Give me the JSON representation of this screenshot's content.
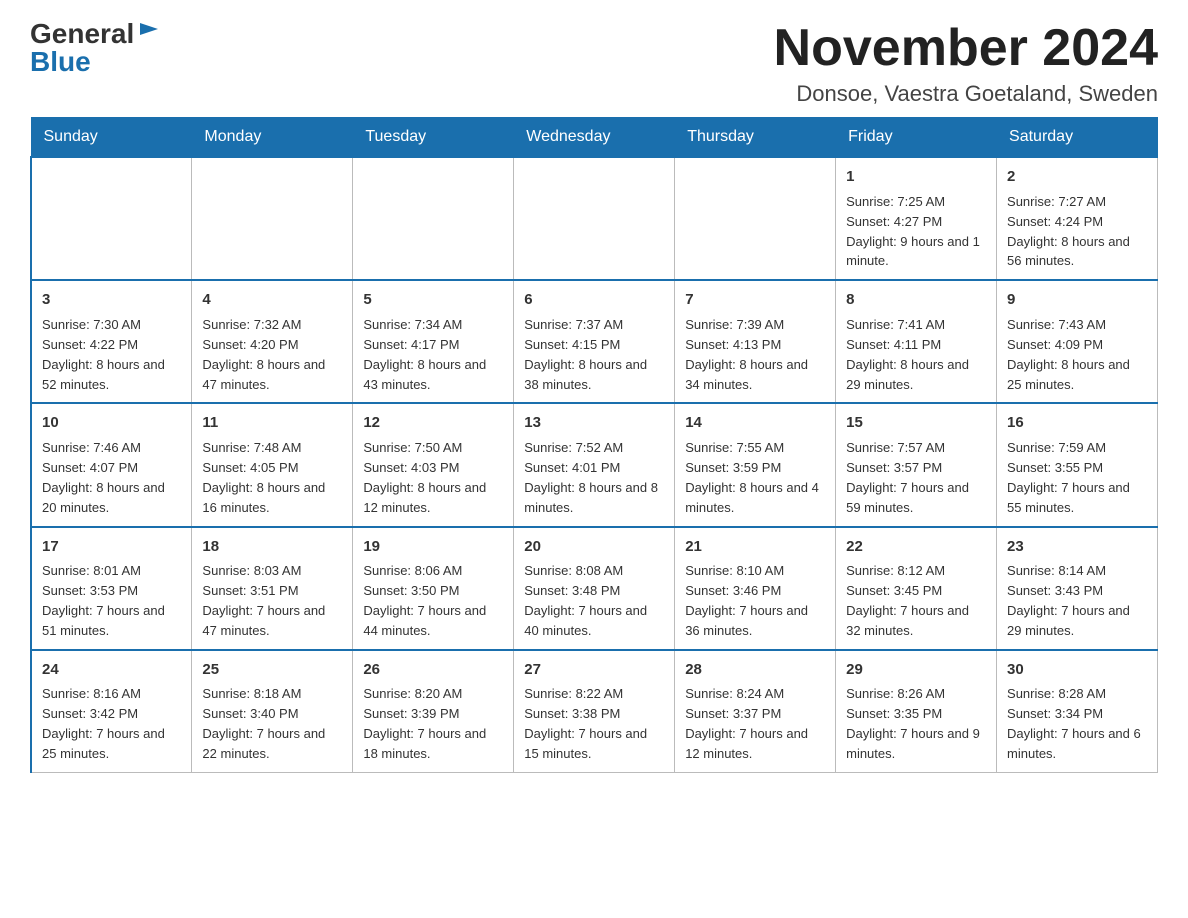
{
  "header": {
    "logo_general": "General",
    "logo_blue": "Blue",
    "month_title": "November 2024",
    "location": "Donsoe, Vaestra Goetaland, Sweden"
  },
  "days_of_week": [
    "Sunday",
    "Monday",
    "Tuesday",
    "Wednesday",
    "Thursday",
    "Friday",
    "Saturday"
  ],
  "weeks": [
    [
      {
        "day": "",
        "info": ""
      },
      {
        "day": "",
        "info": ""
      },
      {
        "day": "",
        "info": ""
      },
      {
        "day": "",
        "info": ""
      },
      {
        "day": "",
        "info": ""
      },
      {
        "day": "1",
        "info": "Sunrise: 7:25 AM\nSunset: 4:27 PM\nDaylight: 9 hours and 1 minute."
      },
      {
        "day": "2",
        "info": "Sunrise: 7:27 AM\nSunset: 4:24 PM\nDaylight: 8 hours and 56 minutes."
      }
    ],
    [
      {
        "day": "3",
        "info": "Sunrise: 7:30 AM\nSunset: 4:22 PM\nDaylight: 8 hours and 52 minutes."
      },
      {
        "day": "4",
        "info": "Sunrise: 7:32 AM\nSunset: 4:20 PM\nDaylight: 8 hours and 47 minutes."
      },
      {
        "day": "5",
        "info": "Sunrise: 7:34 AM\nSunset: 4:17 PM\nDaylight: 8 hours and 43 minutes."
      },
      {
        "day": "6",
        "info": "Sunrise: 7:37 AM\nSunset: 4:15 PM\nDaylight: 8 hours and 38 minutes."
      },
      {
        "day": "7",
        "info": "Sunrise: 7:39 AM\nSunset: 4:13 PM\nDaylight: 8 hours and 34 minutes."
      },
      {
        "day": "8",
        "info": "Sunrise: 7:41 AM\nSunset: 4:11 PM\nDaylight: 8 hours and 29 minutes."
      },
      {
        "day": "9",
        "info": "Sunrise: 7:43 AM\nSunset: 4:09 PM\nDaylight: 8 hours and 25 minutes."
      }
    ],
    [
      {
        "day": "10",
        "info": "Sunrise: 7:46 AM\nSunset: 4:07 PM\nDaylight: 8 hours and 20 minutes."
      },
      {
        "day": "11",
        "info": "Sunrise: 7:48 AM\nSunset: 4:05 PM\nDaylight: 8 hours and 16 minutes."
      },
      {
        "day": "12",
        "info": "Sunrise: 7:50 AM\nSunset: 4:03 PM\nDaylight: 8 hours and 12 minutes."
      },
      {
        "day": "13",
        "info": "Sunrise: 7:52 AM\nSunset: 4:01 PM\nDaylight: 8 hours and 8 minutes."
      },
      {
        "day": "14",
        "info": "Sunrise: 7:55 AM\nSunset: 3:59 PM\nDaylight: 8 hours and 4 minutes."
      },
      {
        "day": "15",
        "info": "Sunrise: 7:57 AM\nSunset: 3:57 PM\nDaylight: 7 hours and 59 minutes."
      },
      {
        "day": "16",
        "info": "Sunrise: 7:59 AM\nSunset: 3:55 PM\nDaylight: 7 hours and 55 minutes."
      }
    ],
    [
      {
        "day": "17",
        "info": "Sunrise: 8:01 AM\nSunset: 3:53 PM\nDaylight: 7 hours and 51 minutes."
      },
      {
        "day": "18",
        "info": "Sunrise: 8:03 AM\nSunset: 3:51 PM\nDaylight: 7 hours and 47 minutes."
      },
      {
        "day": "19",
        "info": "Sunrise: 8:06 AM\nSunset: 3:50 PM\nDaylight: 7 hours and 44 minutes."
      },
      {
        "day": "20",
        "info": "Sunrise: 8:08 AM\nSunset: 3:48 PM\nDaylight: 7 hours and 40 minutes."
      },
      {
        "day": "21",
        "info": "Sunrise: 8:10 AM\nSunset: 3:46 PM\nDaylight: 7 hours and 36 minutes."
      },
      {
        "day": "22",
        "info": "Sunrise: 8:12 AM\nSunset: 3:45 PM\nDaylight: 7 hours and 32 minutes."
      },
      {
        "day": "23",
        "info": "Sunrise: 8:14 AM\nSunset: 3:43 PM\nDaylight: 7 hours and 29 minutes."
      }
    ],
    [
      {
        "day": "24",
        "info": "Sunrise: 8:16 AM\nSunset: 3:42 PM\nDaylight: 7 hours and 25 minutes."
      },
      {
        "day": "25",
        "info": "Sunrise: 8:18 AM\nSunset: 3:40 PM\nDaylight: 7 hours and 22 minutes."
      },
      {
        "day": "26",
        "info": "Sunrise: 8:20 AM\nSunset: 3:39 PM\nDaylight: 7 hours and 18 minutes."
      },
      {
        "day": "27",
        "info": "Sunrise: 8:22 AM\nSunset: 3:38 PM\nDaylight: 7 hours and 15 minutes."
      },
      {
        "day": "28",
        "info": "Sunrise: 8:24 AM\nSunset: 3:37 PM\nDaylight: 7 hours and 12 minutes."
      },
      {
        "day": "29",
        "info": "Sunrise: 8:26 AM\nSunset: 3:35 PM\nDaylight: 7 hours and 9 minutes."
      },
      {
        "day": "30",
        "info": "Sunrise: 8:28 AM\nSunset: 3:34 PM\nDaylight: 7 hours and 6 minutes."
      }
    ]
  ]
}
